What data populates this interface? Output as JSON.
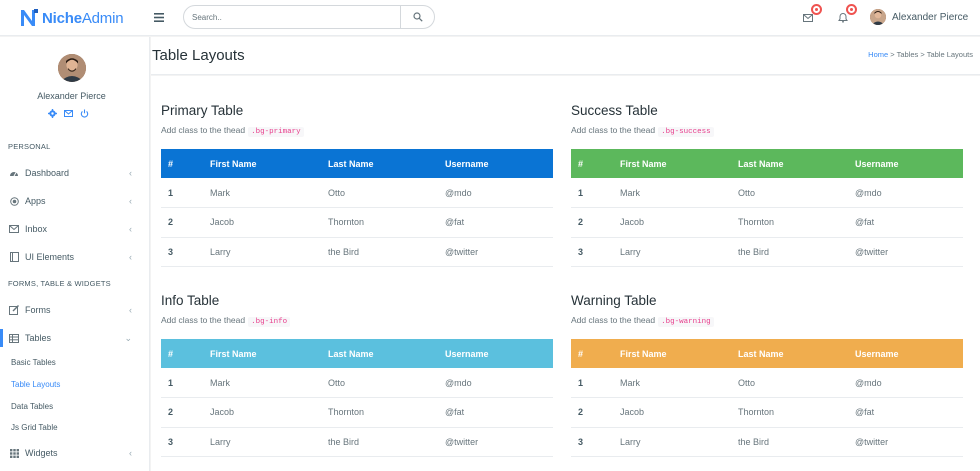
{
  "header": {
    "brand": "NicheAdmin",
    "search_placeholder": "Search..",
    "user_name": "Alexander Pierce"
  },
  "sidebar": {
    "user_name": "Alexander Pierce",
    "captions": [
      "PERSONAL",
      "FORMS, TABLE & WIDGETS"
    ],
    "items": [
      {
        "label": "Dashboard"
      },
      {
        "label": "Apps"
      },
      {
        "label": "Inbox"
      },
      {
        "label": "UI Elements"
      },
      {
        "label": "Forms"
      },
      {
        "label": "Tables"
      },
      {
        "label": "Widgets"
      }
    ],
    "subitems": [
      {
        "label": "Basic Tables"
      },
      {
        "label": "Table Layouts"
      },
      {
        "label": "Data Tables"
      },
      {
        "label": "Js Grid Table"
      }
    ]
  },
  "page": {
    "title": "Table Layouts",
    "breadcrumb": {
      "home": "Home",
      "sep": " > ",
      "section": "Tables",
      "current": "Table Layouts"
    }
  },
  "columns": [
    "#",
    "First Name",
    "Last Name",
    "Username"
  ],
  "tables": [
    {
      "title": "Primary Table",
      "sub": "Add class to the thead",
      "code": ".bg-primary",
      "color": "#0a74d4",
      "rows": [
        [
          "1",
          "Mark",
          "Otto",
          "@mdo"
        ],
        [
          "2",
          "Jacob",
          "Thornton",
          "@fat"
        ],
        [
          "3",
          "Larry",
          "the Bird",
          "@twitter"
        ]
      ]
    },
    {
      "title": "Success Table",
      "sub": "Add class to the thead",
      "code": ".bg-success",
      "color": "#5cb85c",
      "rows": [
        [
          "1",
          "Mark",
          "Otto",
          "@mdo"
        ],
        [
          "2",
          "Jacob",
          "Thornton",
          "@fat"
        ],
        [
          "3",
          "Larry",
          "the Bird",
          "@twitter"
        ]
      ]
    },
    {
      "title": "Info Table",
      "sub": "Add class to the thead",
      "code": ".bg-info",
      "color": "#5bc0de",
      "rows": [
        [
          "1",
          "Mark",
          "Otto",
          "@mdo"
        ],
        [
          "2",
          "Jacob",
          "Thornton",
          "@fat"
        ],
        [
          "3",
          "Larry",
          "the Bird",
          "@twitter"
        ]
      ]
    },
    {
      "title": "Warning Table",
      "sub": "Add class to the thead",
      "code": ".bg-warning",
      "color": "#f0ad4e",
      "rows": [
        [
          "1",
          "Mark",
          "Otto",
          "@mdo"
        ],
        [
          "2",
          "Jacob",
          "Thornton",
          "@fat"
        ],
        [
          "3",
          "Larry",
          "the Bird",
          "@twitter"
        ]
      ]
    }
  ]
}
